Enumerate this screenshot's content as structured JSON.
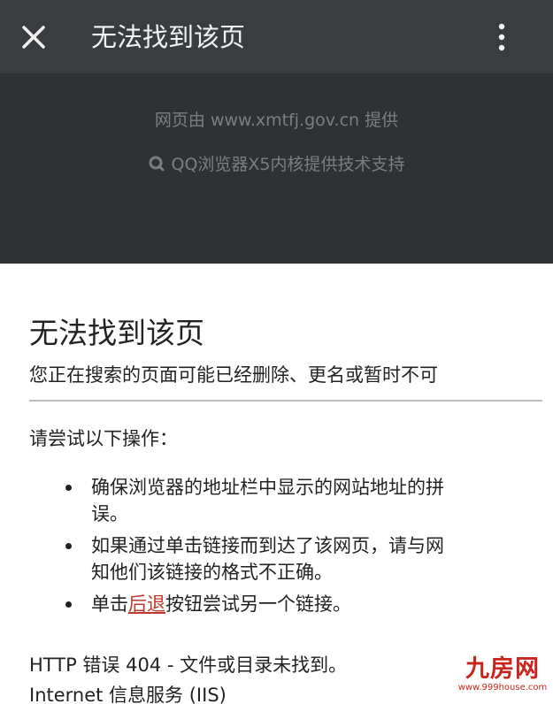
{
  "topbar": {
    "title": "无法找到该页",
    "close_icon": "close-icon",
    "more_icon": "more-vertical-icon"
  },
  "provider": {
    "line1": "网页由 www.xmtfj.gov.cn 提供",
    "line2": "QQ浏览器X5内核提供技术支持",
    "qq_icon": "qq-browser-icon"
  },
  "page": {
    "title": "无法找到该页",
    "description": "您正在搜索的页面可能已经删除、更名或暂时不可",
    "try_heading": "请尝试以下操作：",
    "tips": [
      {
        "line1": "确保浏览器的地址栏中显示的网站地址的拼",
        "line2": "误。"
      },
      {
        "line1": "如果通过单击链接而到达了该网页，请与网",
        "line2": "知他们该链接的格式不正确。"
      },
      {
        "prefix": "单击",
        "link": "后退",
        "suffix": "按钮尝试另一个链接。"
      }
    ],
    "http_error": "HTTP 错误 404 - 文件或目录未找到。",
    "iis_line": "Internet 信息服务 (IIS)"
  },
  "watermark": {
    "name": "九房网",
    "url": "www.999house.com"
  },
  "colors": {
    "topbar_bg": "#3a3d40",
    "banner_bg": "#2f3235",
    "banner_text": "#7b7e81",
    "link": "#c0392b",
    "watermark": "#c9251f"
  }
}
